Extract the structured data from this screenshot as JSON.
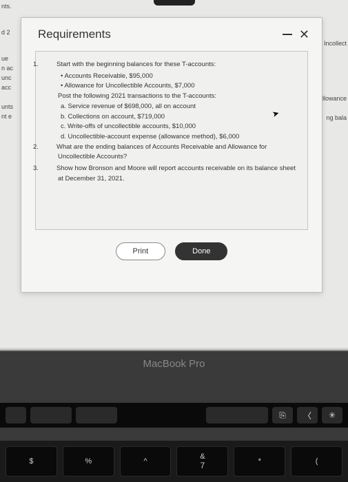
{
  "modal": {
    "title": "Requirements",
    "items": {
      "n1": "1.",
      "n2": "2.",
      "n3": "3.",
      "text1": "Start with the beginning balances for these T-accounts:",
      "bullet1": "• Accounts Receivable, $95,000",
      "bullet2": "• Allowance for Uncollectible Accounts, $7,000",
      "post": "Post the following 2021 transactions to the T-accounts:",
      "a": "a.  Service revenue of $698,000, all on account",
      "b": "b.  Collections on account, $719,000",
      "c": "c.  Write-offs of uncollectible accounts, $10,000",
      "d": "d.  Uncollectible-account expense (allowance method), $6,000",
      "text2": "What are the ending balances of Accounts Receivable and Allowance for Uncollectible Accounts?",
      "text3": "Show how Bronson and Moore will report accounts receivable on its balance sheet at December 31, 2021."
    },
    "buttons": {
      "print": "Print",
      "done": "Done"
    }
  },
  "bg": {
    "l1": "nts.",
    "l2": "d 2",
    "l3": "ue",
    "l4": "n ac",
    "l5": "unc",
    "l6": "acc",
    "l7": "unts",
    "l8": "nt e",
    "r1": "Incollect",
    "r2": "llowance",
    "r3": "ng bala"
  },
  "device": {
    "label": "MacBook Pro"
  },
  "keys": {
    "k1": "$",
    "k2": "%",
    "k3": "^",
    "k4": "&",
    "k5": "*",
    "k6": "(",
    "k1b": "",
    "k2b": "",
    "k3b": "",
    "k4b": "7",
    "k5b": "",
    "k6b": ""
  }
}
